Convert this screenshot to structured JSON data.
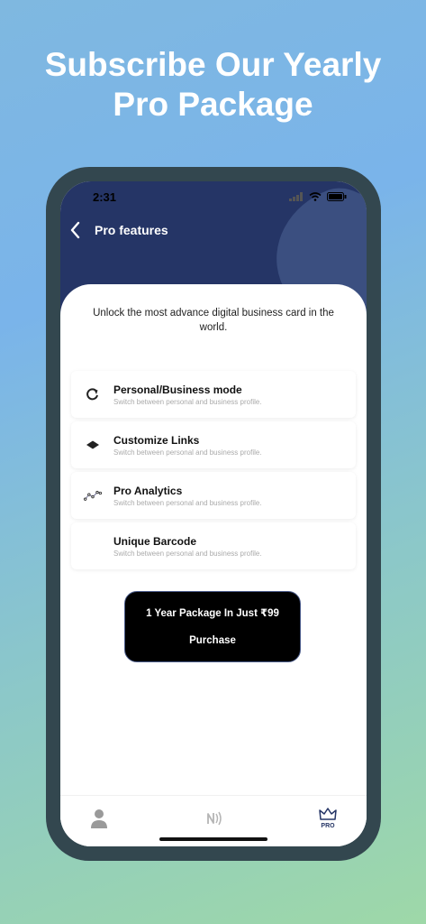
{
  "headline": {
    "line1": "Subscribe Our Yearly",
    "line2": "Pro Package"
  },
  "status_bar": {
    "time": "2:31"
  },
  "nav": {
    "title": "Pro features"
  },
  "subtitle": "Unlock the most advance digital business card in the world.",
  "features": [
    {
      "title": "Personal/Business mode",
      "desc": "Switch between personal and business profile.",
      "icon": "refresh-icon"
    },
    {
      "title": "Customize Links",
      "desc": "Switch between personal and business profile.",
      "icon": "diamond-icon"
    },
    {
      "title": "Pro Analytics",
      "desc": "Switch between personal and business profile.",
      "icon": "analytics-icon"
    },
    {
      "title": "Unique Barcode",
      "desc": "Switch between personal and business profile.",
      "icon": ""
    }
  ],
  "purchase": {
    "line1": "1 Year Package In Just ₹99",
    "line2": "Purchase"
  },
  "tabs": {
    "pro_label": "PRO"
  },
  "colors": {
    "header_bg": "#253566",
    "button_bg": "#000000",
    "text_white": "#ffffff"
  }
}
